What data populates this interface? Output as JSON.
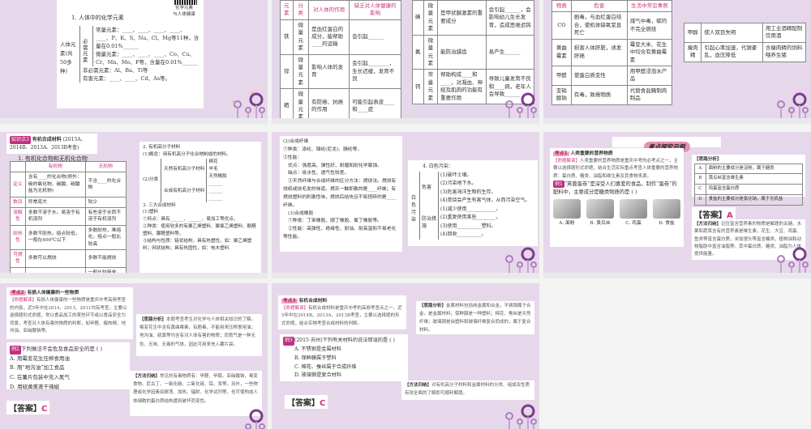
{
  "slide1": {
    "qr_caption": "化学元素\n与人体健康",
    "title": "1. 人体中的化学元素",
    "body": "人体元素(共50多种)",
    "essential": "必需元素",
    "macro": "常量元素：____、____、____、____、____、P、K、S、Na、Cl、Mg等11种，含量在0.01%______",
    "micro": "微量元素：____、____、____、Co、Cu、Cr、Mn、Mo、F等，含量在0.01%______",
    "nonessential": "非必需元素：Al、Ba、Ti等",
    "harmful": "有害元素：____、____、Cd、As等。"
  },
  "slide2": {
    "left_table": {
      "headers": [
        "元素",
        "分类",
        "对人体的作用",
        "缺乏对人体健康的影响"
      ],
      "rows": [
        [
          "铁",
          "微量元素",
          "是血红蛋白的成分，能帮助____的运输",
          "会引起______"
        ],
        [
          "锌",
          "微量元素",
          "影响人体的发育",
          "会引起________，生长迟缓，发育不良"
        ],
        [
          "硒",
          "微量元素",
          "有防癌、抗癌的作用",
          "可能引起表皮____和____症"
        ]
      ]
    },
    "right_table": {
      "rows": [
        [
          "碘",
          "微量元素",
          "是甲状腺激素的重要成分",
          "会引起______，会影响幼儿生长发育，造成思维迟钝"
        ],
        [
          "氟",
          "微量元素",
          "能防治龋齿",
          "易产生______"
        ],
        [
          "钙",
          "常量元素",
          "帮助构成____和____，对凝血、神经及肌肉的功能有重要作用",
          "导致儿童发育不良和____病，老年人会导致______"
        ]
      ]
    }
  },
  "slide3": {
    "left_table": {
      "headers": [
        "物质",
        "危害",
        "生活中常见事例"
      ],
      "rows": [
        [
          "CO",
          "剧毒，与血红蛋白结合，使机体缺氧窒息死亡",
          "煤气中毒，碳的不完全燃烧"
        ],
        [
          "黄曲霉素",
          "损害人体肝脏，诱发肝癌",
          "霉变大米、花生中均含有黄曲霉素"
        ],
        [
          "甲醛",
          "使蛋白质变性",
          "用甲醛浸泡水产品"
        ],
        [
          "亚硝酸钠",
          "有毒，致癌物质",
          "代替食盐腌制肉制品"
        ]
      ]
    },
    "right_table": {
      "rows": [
        [
          "甲醇",
          "使人双目失明",
          "用工业酒精配制饮用酒"
        ],
        [
          "瘦肉精",
          "引起心率加速，代谢紊乱，血压降低",
          "含瘦肉精的饲料喂养生猪"
        ]
      ]
    }
  },
  "slide4": {
    "tag": "知识点3",
    "heading": "有机合成材料",
    "years": "(2015A、2014B、2013A、2013B考查)",
    "subtitle": "1. 有机化合物和无机化合物",
    "table": {
      "headers": [
        "",
        "有机物",
        "无机物"
      ],
      "rows": [
        [
          "定义",
          "含有____的化合物(例外：碳的氧化物、碳酸、碳酸盐为无机物)",
          "不含____的化合物"
        ],
        [
          "数目",
          "异常庞大",
          "较少"
        ],
        [
          "溶解性",
          "多数不溶于水，易溶于有机溶剂",
          "有些溶于水而不溶于有机溶剂"
        ],
        [
          "耐热性",
          "多数不耐热，熔点较低，一般在400℃以下",
          "多数耐热，难熔化，熔点一般比较高"
        ],
        [
          "可燃性",
          "多数可以燃烧",
          "多数不能燃烧"
        ],
        [
          "化学反应",
          "一般比较复杂，副反应较多，反应速率较慢",
          "一般比较简单，副反应少，反应速率较快"
        ]
      ]
    },
    "right": {
      "l1": "2. 有机高分子材料",
      "l2": "(1)概念：用有机高分子化合物制成的材料。",
      "l3": "(2)分类",
      "natural": "天然有机高分子材料",
      "natural_items": "棉花\n羊毛\n天然橡胶",
      "synthetic": "合成有机高分子材料",
      "synthetic_items": "______\n______\n______",
      "l4": "3. 三大合成材料",
      "l5": "(1)塑料",
      "l6": "①特点：具有______、______、易加工等优点。",
      "l7": "②种类：使用较多的有聚乙烯塑料、聚氯乙烯塑料、酚醛塑料、脲醛塑料等。",
      "l8": "③结构与性质：链状结构，具有热塑性，如：聚乙烯塑料；网状结构，具有热固性，如：电木塑料"
    }
  },
  "slide5": {
    "left": {
      "l1": "(2)合成纤维",
      "l2": "①种类：涤纶、锦纶(尼龙)、腈纶等。",
      "l3": "②性能：",
      "l4": "优点：强度高、弹性好、耐磨和耐化学腐蚀。",
      "l5": "缺点：吸水性、透气性较差。",
      "l6": "②天然纤维与合成纤维的区分方法：燃烧法。燃烧有烧纸或烧毛发的味道，燃灰一触即散的是____纤维；有燃烧塑料的刺激性味，燃烧后结块且不易捏碎的是____纤维。",
      "l7": "(3)合成橡胶",
      "l8": "①种类：丁苯橡胶、顺丁橡胶、氯丁橡胶等。",
      "l9": "②性能：高弹性、绝缘性、耐油、耐高温和不易老化等性能。"
    },
    "right": {
      "title": "4. 白色污染：",
      "side": "白色污染",
      "harm": "危害",
      "harm_items": [
        "(1)破坏土壤。",
        "(2)污染地下水。",
        "(3)危害海洋生物的生存。",
        "(4)焚烧会产生有害气体，从而污染空气。"
      ],
      "measures": "防治措施",
      "measure_items": [
        "(1)减少使用____________。",
        "(2)重复使用某些________。",
        "(3)使用__________塑料。",
        "(4)回收__________。"
      ]
    }
  },
  "slide6": {
    "banner": "考点探究示例",
    "kd_tag": "考点1",
    "kd_title": "人类重要的营养物质",
    "mingti_tag": "【命题解读】",
    "mingti": "人类重要的营养物质是重庆中考的必考点之一，主要以选择题形式命题，结合生活实际重点考查人体重要的营养物质：蛋白质、糖类、油脂和维生素及其食物来源。",
    "example_tag": "例1",
    "example": "“芙蓉蛋卷”是深受人们喜爱的食品，制作“蛋卷”的配料中，主要成分是糖类物质的是  (    )",
    "options": [
      "A. 面粉",
      "B. 黄瓜丝",
      "C. 鸡蛋",
      "D. 食盐"
    ],
    "analysis_title": "【思路分析】",
    "analysis": [
      [
        "A",
        "面粉的主要成分是淀粉，属于糖类"
      ],
      [
        "B",
        "黄瓜丝富含维生素"
      ],
      [
        "C",
        "鸡蛋富含蛋白质"
      ],
      [
        "D",
        "食盐的主要成分是氯化钠，属于无机盐"
      ]
    ],
    "answer_label": "【答案】",
    "answer": "A",
    "method_tag": "【方法归纳】",
    "method": "记住富含营养素的物质是解题的关键。水果和蔬菜含有的营养素是维生素，花生、大豆、鸡蛋、鱼类等富含蛋白质，米饭馒头等富含糖类，植物油和动物脂肪中富含油脂等。其中蛋白质、糖类、油脂为人体提供能量。"
  },
  "slide7": {
    "kd_tag": "考点2",
    "kd_title": "有损人体健康的一些物质",
    "mingti_tag": "【命题解读】",
    "mingti": "有损人体健康的一些物质是重庆中考高频考查的内容，近5年中在2014、2013、2011均有考查，主要以选择题形式命题，常以食品加工的某些环节或以食品安全为背景，考查对人体有害的物质的判断，如甲醛、瘦肉精、地沟油、亚硝酸钠等。",
    "example_tag": "例2",
    "example": "下列做法不会危及食品安全的是  (    )",
    "options": [
      "A. 用霉变花生压榨食用油",
      "B. 用“地沟油”加工食品",
      "C. 在薯片包装中充入氮气",
      "D. 用硫黄熏蒸干辣椒"
    ],
    "answer_label": "【答案】",
    "answer": "C",
    "analysis_tag": "【思路分析】",
    "analysis": "本题考查考生对化学与人体相关知识的了解。霉变花生中含有黄曲霉素，有剧毒，不能用来压榨食用油；地沟油、硫黄等均含有对人体有害的物质；而氮气是一种无色、无味、无毒的气体，因此可用来充入薯片袋。",
    "method_tag": "【方法归纳】",
    "method": "常见的有毒物质有：甲醛、甲醇、亚硝酸钠、霉变食物、尼古丁、一氧化碳、二氧化硫、铅、汞等。另外，一些物理或化学因素如振荡、加热、辐射、化学试剂等，也可使构成人体细胞的蛋白质结构遭到破坏而变性。"
  },
  "slide8": {
    "kd_tag": "考点3",
    "kd_title": "有机合成材料",
    "mingti_tag": "【命题解读】",
    "mingti": "有机合成材料是重庆中考的高频考查点之一，近5年中在2014B、2013A、2013B考查，主要以选择题的形式命题，结合实物考查合成材料的判断。",
    "example_tag": "例3",
    "example": "(2015·苏州)下列有关材料的说法错误的是  (    )",
    "options": [
      "A. 不锈钢是金属材料",
      "B. 保鲜膜属于塑料",
      "C. 棉花、蚕丝属于合成纤维",
      "D. 玻璃钢是复合材料"
    ],
    "answer_label": "【答案】",
    "answer": "C",
    "analysis_tag": "【思路分析】",
    "analysis": "金属材料包括纯金属和合金，不锈钢属于合金，是金属材料；保鲜膜是一种塑料；棉花、蚕丝是天然纤维；玻璃钢是由塑料和玻璃纤维复合而成的，属于复合材料。",
    "method_tag": "【方法归纳】",
    "method": "对有机高分子材料和金属材料的分类、组成及性质有较全面的了解即可顺利解题。"
  },
  "colors": {
    "slide_bg": "#e6d8ea",
    "accent": "#d0307f"
  }
}
